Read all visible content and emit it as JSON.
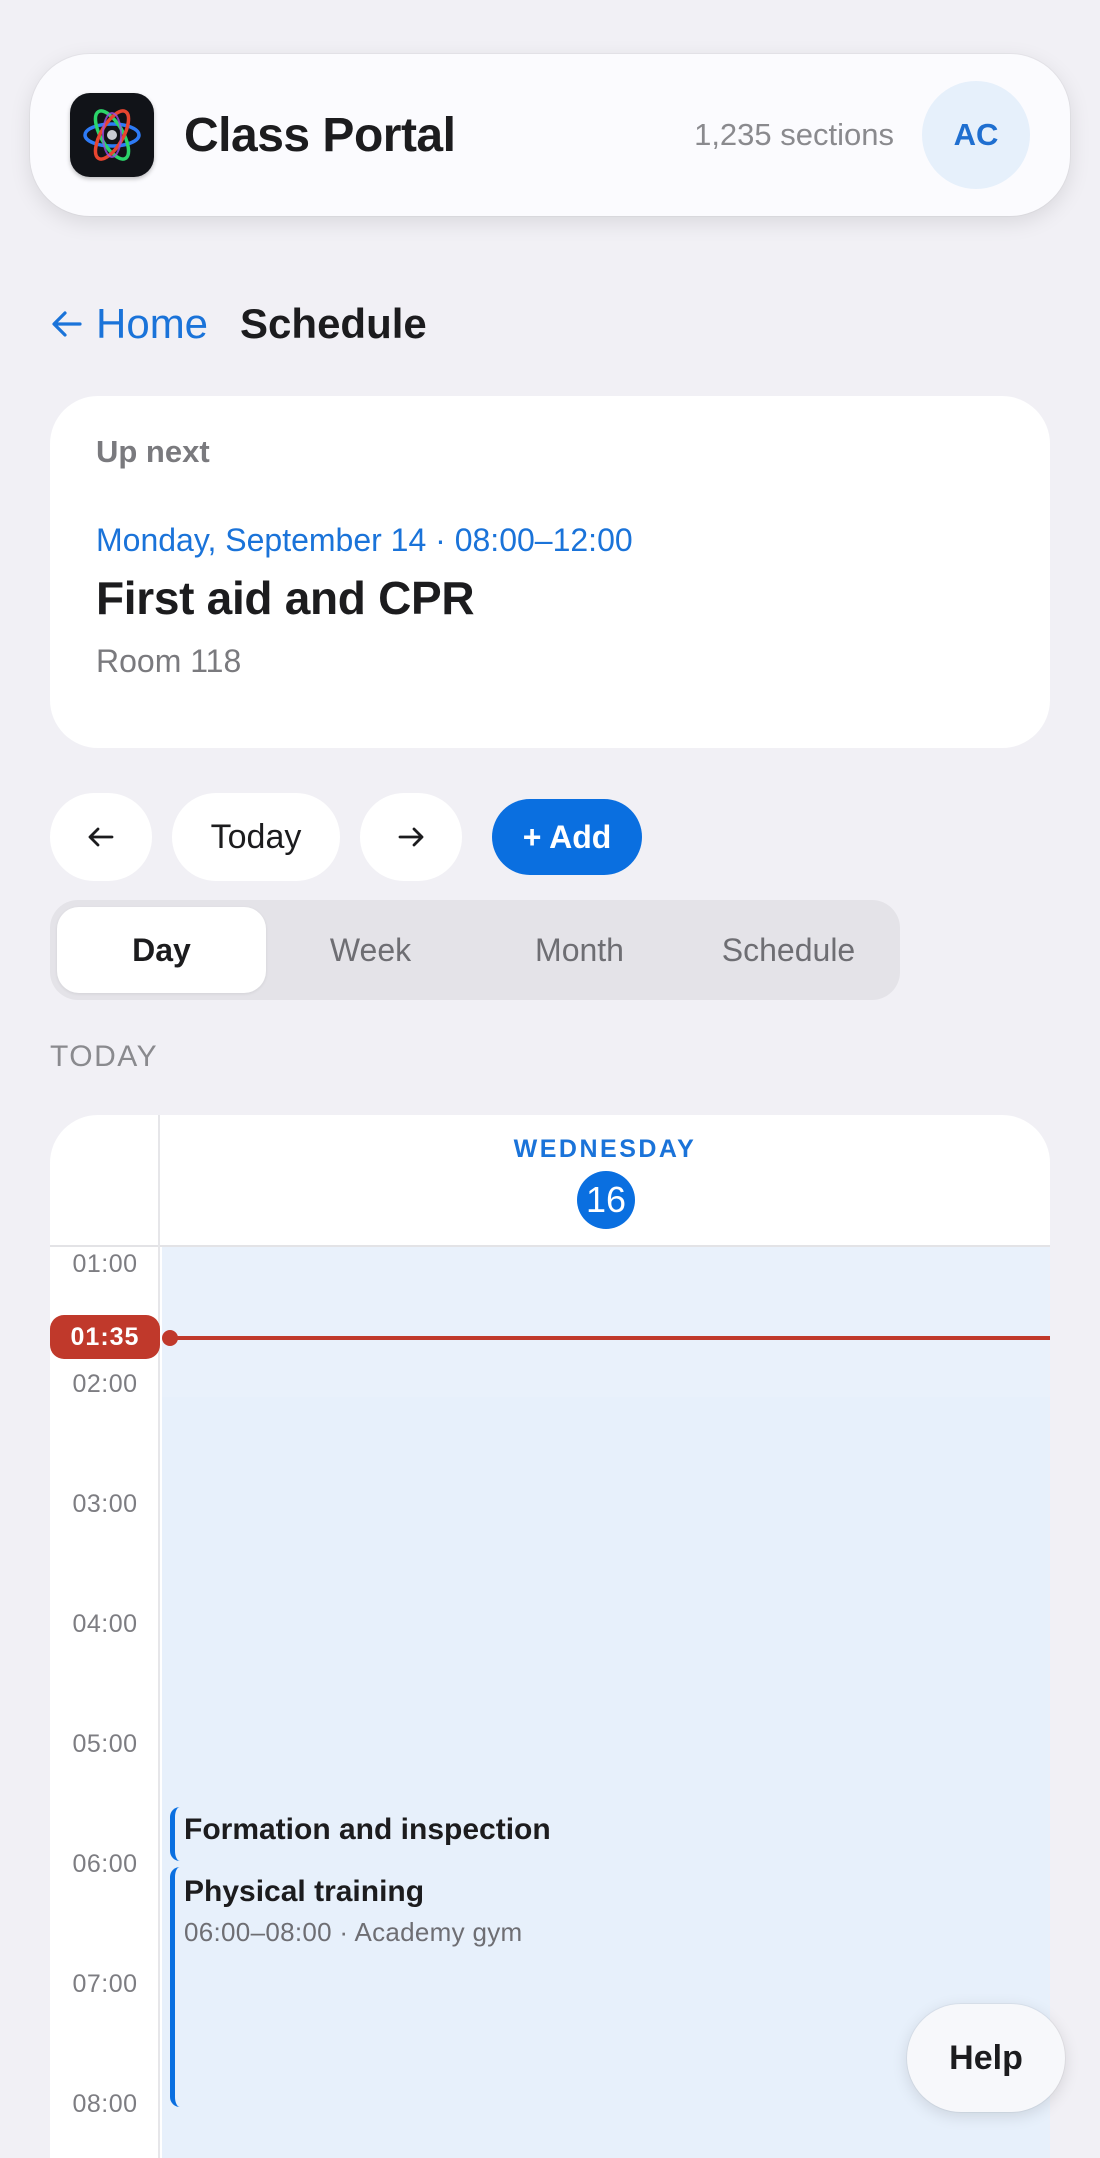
{
  "header": {
    "app_title": "Class Portal",
    "section_count": "1,235 sections",
    "avatar_initials": "AC",
    "app_icon": "atom-icon"
  },
  "breadcrumb": {
    "back_label": "Home",
    "back_icon": "arrow-left-icon",
    "current": "Schedule"
  },
  "up_next": {
    "label": "Up next",
    "datetime": "Monday, September 14 · 08:00–12:00",
    "title": "First aid and CPR",
    "location": "Room 118"
  },
  "toolbar": {
    "prev_icon": "arrow-left-icon",
    "today_label": "Today",
    "next_icon": "arrow-right-icon",
    "add_label": "+ Add"
  },
  "views": {
    "tabs": [
      {
        "label": "Day",
        "active": true
      },
      {
        "label": "Week",
        "active": false
      },
      {
        "label": "Month",
        "active": false
      },
      {
        "label": "Schedule",
        "active": false
      }
    ]
  },
  "section_label": "TODAY",
  "calendar": {
    "day_name": "WEDNESDAY",
    "day_number": "16",
    "hours": [
      "01:00",
      "02:00",
      "03:00",
      "04:00",
      "05:00",
      "06:00",
      "07:00",
      "08:00"
    ],
    "now_time": "01:35",
    "events": [
      {
        "title": "Formation and inspection",
        "meta": ""
      },
      {
        "title": "Physical training",
        "meta": "06:00–08:00 · Academy gym"
      }
    ]
  },
  "help_label": "Help",
  "colors": {
    "accent": "#0a6fe0",
    "now_indicator": "#c0392b",
    "background": "#f1f0f5",
    "day_column": "#e7f0fb"
  }
}
